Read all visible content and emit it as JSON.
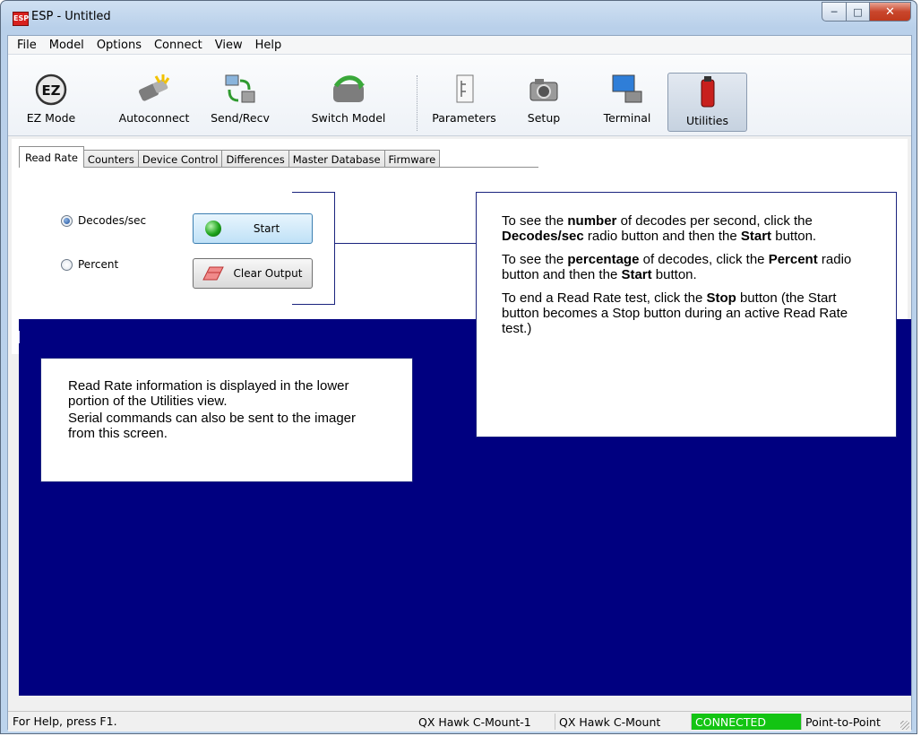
{
  "window": {
    "title": "ESP - Untitled",
    "app_icon_text": "ESP"
  },
  "menu": [
    "File",
    "Model",
    "Options",
    "Connect",
    "View",
    "Help"
  ],
  "toolbar": {
    "ez_mode": "EZ Mode",
    "autoconnect": "Autoconnect",
    "send_recv": "Send/Recv",
    "switch_model": "Switch Model",
    "parameters": "Parameters",
    "setup": "Setup",
    "terminal": "Terminal",
    "utilities": "Utilities"
  },
  "tabs": [
    "Read Rate",
    "Counters",
    "Device Control",
    "Differences",
    "Master Database",
    "Firmware"
  ],
  "read_rate": {
    "decodes_label": "Decodes/sec",
    "percent_label": "Percent",
    "selected": "Decodes/sec",
    "start_label": "Start",
    "clear_label": "Clear Output"
  },
  "callouts": {
    "right": {
      "p1_a": "To see the ",
      "p1_b": "number",
      "p1_c": " of decodes per second, click the ",
      "p1_d": "Decodes/sec",
      "p1_e": " radio button and then the ",
      "p1_f": "Start",
      "p1_g": " button.",
      "p2_a": "To see the ",
      "p2_b": "percentage",
      "p2_c": " of decodes, click the ",
      "p2_d": "Percent",
      "p2_e": " radio button and then the ",
      "p2_f": "Start",
      "p2_g": " button.",
      "p3_a": "To end a Read Rate test, click the ",
      "p3_b": "Stop",
      "p3_c": " button (the Start button becomes a Stop button during an active Read Rate test.)"
    },
    "left": {
      "p1": "Read Rate information is displayed in the lower portion of the Utilities view.",
      "p2": "Serial commands can also be sent to the imager from this screen."
    }
  },
  "status": {
    "help": "For Help, press F1.",
    "device_name": "QX Hawk C-Mount-1",
    "model": "QX Hawk C-Mount",
    "connection": "CONNECTED",
    "mode": "Point-to-Point"
  },
  "colors": {
    "output_bg": "#000080",
    "connected": "#13c413",
    "callout_border": "#1a237e"
  }
}
